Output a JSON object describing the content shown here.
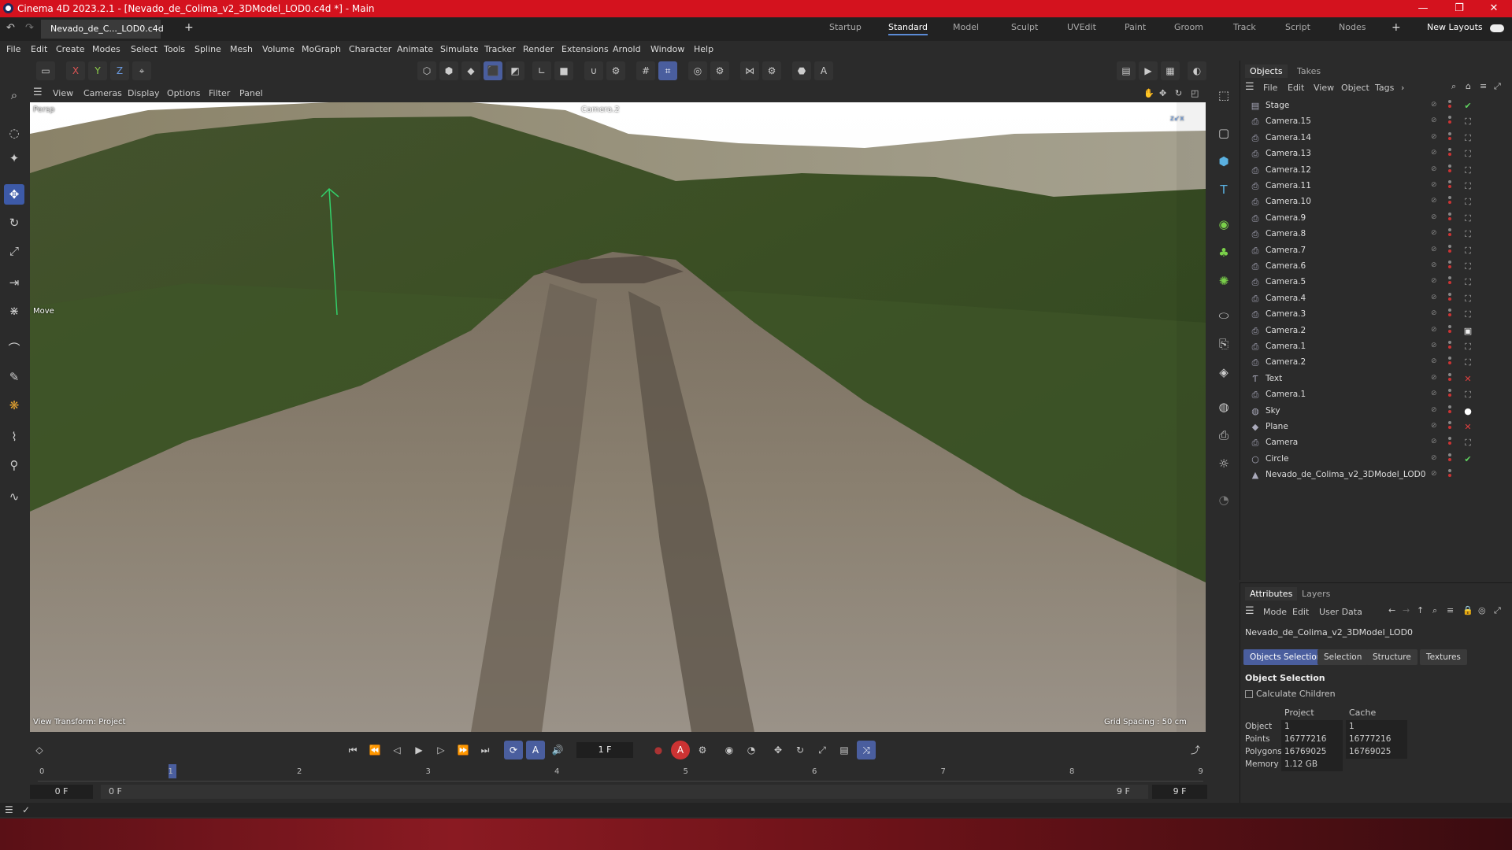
{
  "window": {
    "title": "Cinema 4D 2023.2.1 - [Nevado_de_Colima_v2_3DModel_LOD0.c4d *] - Main",
    "controls": [
      "—",
      "❐",
      "✕"
    ]
  },
  "document_tab": "Nevado_de_C..._LOD0.c4d *",
  "layouts": {
    "items": [
      "Startup",
      "Standard",
      "Model",
      "Sculpt",
      "UVEdit",
      "Paint",
      "Groom",
      "Track",
      "Script",
      "Nodes"
    ],
    "active": "Standard",
    "new_layouts": "New Layouts"
  },
  "menu": [
    "File",
    "Edit",
    "Create",
    "Modes",
    "Select",
    "Tools",
    "Spline",
    "Mesh",
    "Volume",
    "MoGraph",
    "Character",
    "Animate",
    "Simulate",
    "Tracker",
    "Render",
    "Extensions",
    "Arnold",
    "Window",
    "Help"
  ],
  "axis_lock": [
    "X",
    "Y",
    "Z"
  ],
  "viewport": {
    "menu": [
      "View",
      "Cameras",
      "Display",
      "Options",
      "Filter",
      "Panel"
    ],
    "projection": "Persp",
    "camera_name": "Camera.2",
    "active_tool": "Move",
    "view_transform": "View Transform: Project",
    "grid_spacing": "Grid Spacing : 50 cm"
  },
  "objects_panel": {
    "tabs": [
      "Objects",
      "Takes"
    ],
    "menu": [
      "File",
      "Edit",
      "View",
      "Object",
      "Tags"
    ],
    "items": [
      {
        "name": "Stage",
        "icon": "stage-icon",
        "tag": "✔"
      },
      {
        "name": "Camera.15",
        "icon": "camera-icon",
        "tag": "⛶"
      },
      {
        "name": "Camera.14",
        "icon": "camera-icon",
        "tag": "⛶"
      },
      {
        "name": "Camera.13",
        "icon": "camera-icon",
        "tag": "⛶"
      },
      {
        "name": "Camera.12",
        "icon": "camera-icon",
        "tag": "⛶"
      },
      {
        "name": "Camera.11",
        "icon": "camera-icon",
        "tag": "⛶"
      },
      {
        "name": "Camera.10",
        "icon": "camera-icon",
        "tag": "⛶"
      },
      {
        "name": "Camera.9",
        "icon": "camera-icon",
        "tag": "⛶"
      },
      {
        "name": "Camera.8",
        "icon": "camera-icon",
        "tag": "⛶"
      },
      {
        "name": "Camera.7",
        "icon": "camera-icon",
        "tag": "⛶"
      },
      {
        "name": "Camera.6",
        "icon": "camera-icon",
        "tag": "⛶"
      },
      {
        "name": "Camera.5",
        "icon": "camera-icon",
        "tag": "⛶"
      },
      {
        "name": "Camera.4",
        "icon": "camera-icon",
        "tag": "⛶"
      },
      {
        "name": "Camera.3",
        "icon": "camera-icon",
        "tag": "⛶"
      },
      {
        "name": "Camera.2",
        "icon": "camera-icon",
        "tag": "▣"
      },
      {
        "name": "Camera.1",
        "icon": "camera-icon",
        "tag": "⛶"
      },
      {
        "name": "Camera.2",
        "icon": "camera-icon",
        "tag": "⛶"
      },
      {
        "name": "Text",
        "icon": "text-icon",
        "tag": "✕"
      },
      {
        "name": "Camera.1",
        "icon": "camera-icon",
        "tag": "⛶"
      },
      {
        "name": "Sky",
        "icon": "sky-icon",
        "tag": "●"
      },
      {
        "name": "Plane",
        "icon": "plane-icon",
        "tag": "✕"
      },
      {
        "name": "Camera",
        "icon": "camera-icon",
        "tag": "⛶"
      },
      {
        "name": "Circle",
        "icon": "circle-icon",
        "tag": "✔"
      },
      {
        "name": "Nevado_de_Colima_v2_3DModel_LOD0",
        "icon": "mesh-icon",
        "tag": ""
      }
    ]
  },
  "attributes_panel": {
    "tabs": [
      "Attributes",
      "Layers"
    ],
    "menu": [
      "Mode",
      "Edit",
      "User Data"
    ],
    "object_name": "Nevado_de_Colima_v2_3DModel_LOD0",
    "buttons": [
      "Objects Selection",
      "Selection",
      "Structure",
      "Textures"
    ],
    "section_title": "Object Selection",
    "checkbox_label": "Calculate Children",
    "columns": [
      "Project",
      "Cache"
    ],
    "rows": [
      {
        "label": "Object",
        "project": "1",
        "cache": "1"
      },
      {
        "label": "Points",
        "project": "16777216",
        "cache": "16777216"
      },
      {
        "label": "Polygons",
        "project": "16769025",
        "cache": "16769025"
      },
      {
        "label": "Memory",
        "project": "1.12 GB",
        "cache": ""
      }
    ]
  },
  "timeline": {
    "current_frame": "1 F",
    "ticks": [
      "0",
      "1",
      "2",
      "3",
      "4",
      "5",
      "6",
      "7",
      "8",
      "9"
    ],
    "start_field": "0 F",
    "range_start": "0 F",
    "range_end": "9 F",
    "end_field": "9 F"
  }
}
